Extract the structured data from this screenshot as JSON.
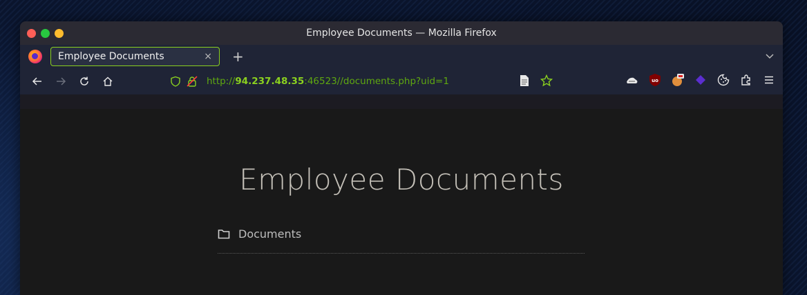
{
  "window": {
    "title": "Employee Documents — Mozilla Firefox"
  },
  "tabs": [
    {
      "label": "Employee Documents",
      "close": "×"
    }
  ],
  "new_tab_label": "+",
  "url": {
    "scheme": "http://",
    "host": "94.237.48.35",
    "rest": ":46523//documents.php?uid=1"
  },
  "page": {
    "heading": "Employee Documents",
    "folder_label": "Documents"
  },
  "colors": {
    "accent": "#8bd11f",
    "background": "#191919",
    "heading": "#c4c0b8"
  },
  "icons": {
    "back": "arrow-left-icon",
    "forward": "arrow-right-icon",
    "reload": "reload-icon",
    "home": "home-icon",
    "shield": "tracking-protection-icon",
    "lock": "insecure-lock-icon",
    "folder": "folder-icon"
  }
}
